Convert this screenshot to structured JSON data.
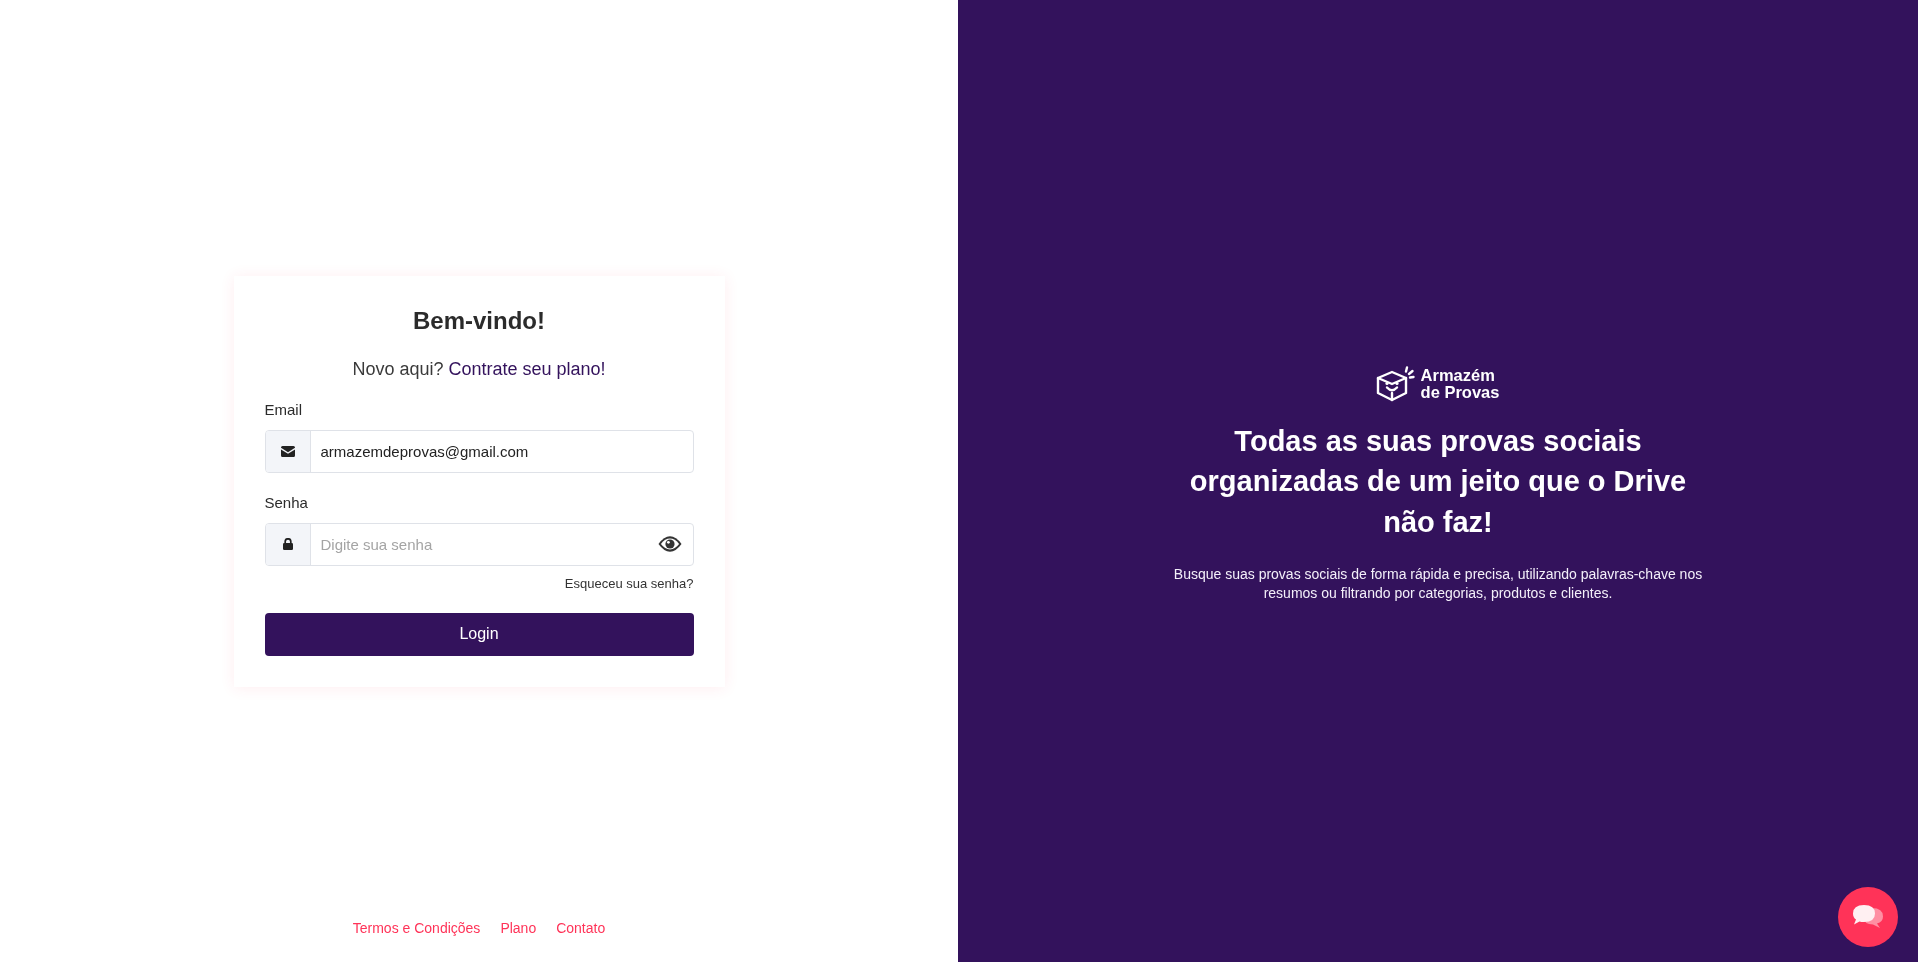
{
  "login_card": {
    "title": "Bem-vindo!",
    "signup_prompt": {
      "text": "Novo aqui?",
      "link": "Contrate seu plano!"
    },
    "fields": [
      {
        "kind": "email",
        "label": "Email",
        "value": "armazemdeprovas@gmail.com"
      },
      {
        "kind": "password",
        "label": "Senha",
        "placeholder": "Digite sua senha"
      }
    ],
    "forgot_link": "Esqueceu sua senha?",
    "submit_button": "Login"
  },
  "footer_links": [
    "Termos e Condições",
    "Plano",
    "Contato"
  ],
  "promo": {
    "logo_lines": [
      "Armazém",
      "de Provas"
    ],
    "headline": "Todas as suas provas sociais organizadas de um jeito que o Drive não faz!",
    "description": "Busque suas provas sociais de forma rápida e precisa, utilizando palavras-chave nos resumos ou filtrando por categorias, produtos e clientes."
  }
}
